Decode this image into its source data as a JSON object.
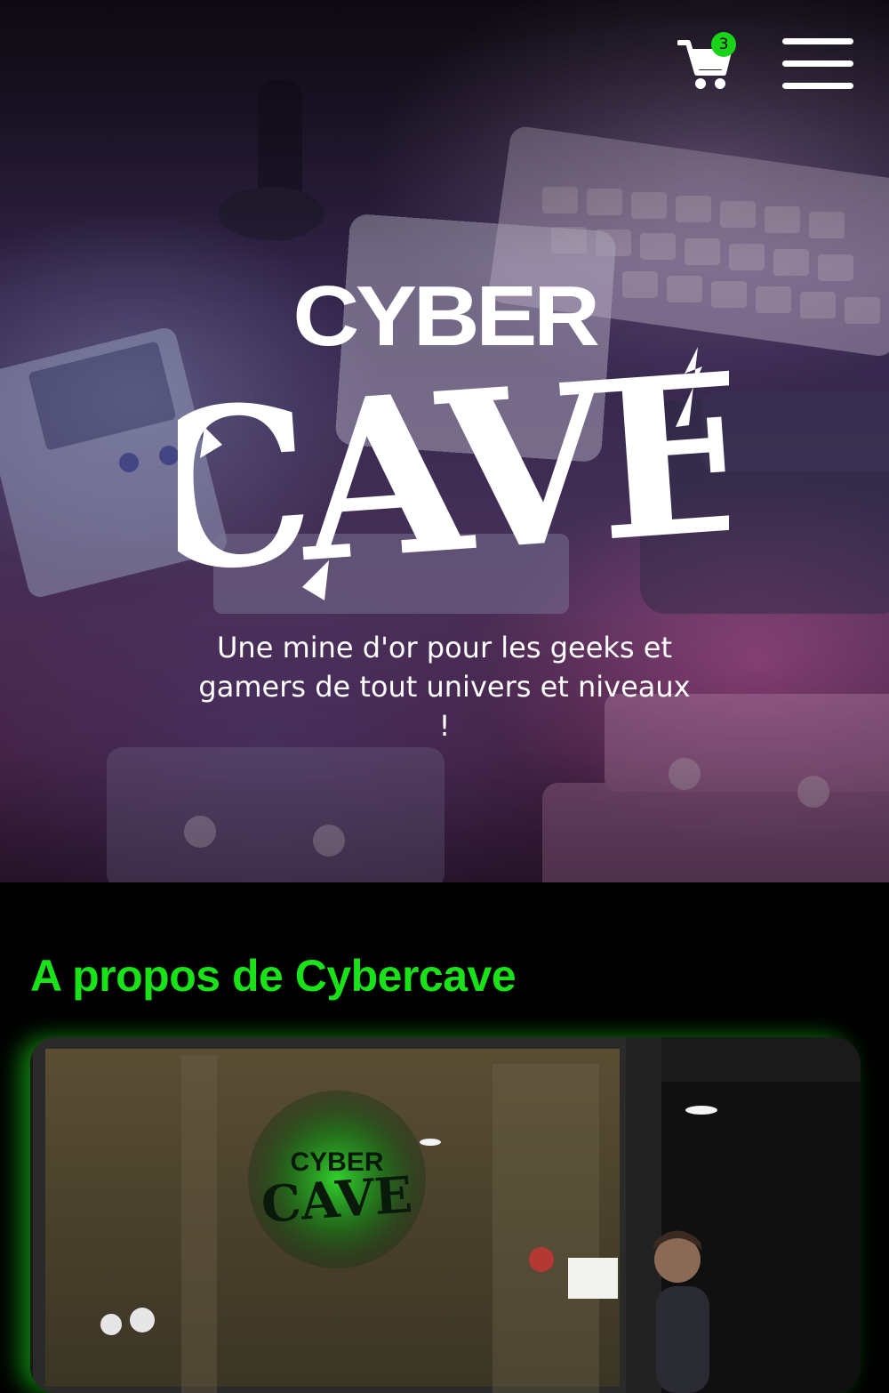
{
  "header": {
    "cart_count": "3",
    "cart_icon": "shopping-cart-icon",
    "menu_icon": "hamburger-menu-icon"
  },
  "hero": {
    "logo_top": "CYBER",
    "logo_bottom": "CAVE",
    "tagline": "Une mine d'or pour les geeks et gamers de tout univers et niveaux !"
  },
  "about": {
    "title": "A propos de Cybercave"
  },
  "colors": {
    "accent_green": "#19e219",
    "background": "#000000",
    "text": "#ffffff"
  }
}
